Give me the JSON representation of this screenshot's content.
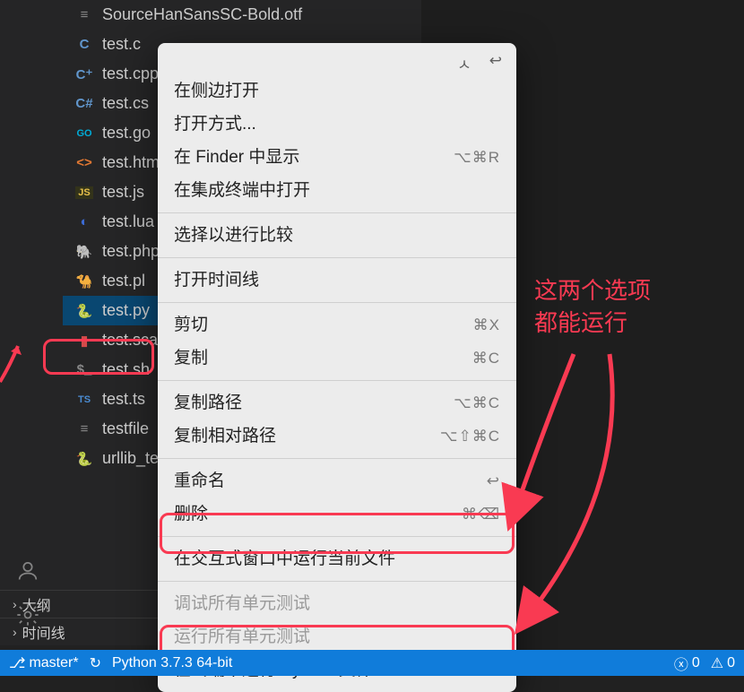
{
  "files": [
    {
      "icon": "≡",
      "cls": "fi-txt",
      "name": "SourceHanSansSC-Bold.otf",
      "sel": false
    },
    {
      "icon": "C",
      "cls": "fi-c",
      "name": "test.c",
      "sel": false
    },
    {
      "icon": "C⁺",
      "cls": "fi-cpp",
      "name": "test.cpp",
      "sel": false
    },
    {
      "icon": "C#",
      "cls": "fi-cs",
      "name": "test.cs",
      "sel": false
    },
    {
      "icon": "GO",
      "cls": "fi-go",
      "name": "test.go",
      "sel": false
    },
    {
      "icon": "<>",
      "cls": "fi-html",
      "name": "test.html",
      "sel": false
    },
    {
      "icon": "JS",
      "cls": "fi-js",
      "name": "test.js",
      "sel": false
    },
    {
      "icon": "◐",
      "cls": "fi-lua",
      "name": "test.lua",
      "sel": false
    },
    {
      "icon": "🐘",
      "cls": "fi-php",
      "name": "test.php",
      "sel": false
    },
    {
      "icon": "🐪",
      "cls": "fi-pl",
      "name": "test.pl",
      "sel": false
    },
    {
      "icon": "🐍",
      "cls": "fi-py",
      "name": "test.py",
      "sel": true
    },
    {
      "icon": "▮",
      "cls": "fi-sc",
      "name": "test.scala",
      "sel": false
    },
    {
      "icon": "$_",
      "cls": "fi-sh",
      "name": "test.sh",
      "sel": false
    },
    {
      "icon": "TS",
      "cls": "fi-ts",
      "name": "test.ts",
      "sel": false
    },
    {
      "icon": "≡",
      "cls": "fi-txt",
      "name": "testfile",
      "sel": false
    },
    {
      "icon": "🐍",
      "cls": "fi-py",
      "name": "urllib_test.py",
      "sel": false
    }
  ],
  "sections": {
    "outline": "大纲",
    "timeline": "时间线"
  },
  "context_menu": {
    "head_left": "ㅅ",
    "head_right": "↩",
    "groups": [
      [
        {
          "label": "在侧边打开",
          "sc": ""
        },
        {
          "label": "打开方式...",
          "sc": ""
        },
        {
          "label": "在 Finder 中显示",
          "sc": "⌥⌘R"
        },
        {
          "label": "在集成终端中打开",
          "sc": ""
        }
      ],
      [
        {
          "label": "选择以进行比较",
          "sc": ""
        }
      ],
      [
        {
          "label": "打开时间线",
          "sc": ""
        }
      ],
      [
        {
          "label": "剪切",
          "sc": "⌘X"
        },
        {
          "label": "复制",
          "sc": "⌘C"
        }
      ],
      [
        {
          "label": "复制路径",
          "sc": "⌥⌘C"
        },
        {
          "label": "复制相对路径",
          "sc": "⌥⇧⌘C"
        }
      ],
      [
        {
          "label": "重命名",
          "sc": "↩"
        },
        {
          "label": "删除",
          "sc": "⌘⌫"
        }
      ],
      [
        {
          "label": "在交互式窗口中运行当前文件",
          "sc": ""
        }
      ],
      [
        {
          "label": "调试所有单元测试",
          "sc": "",
          "disabled": true
        },
        {
          "label": "运行所有单元测试",
          "sc": "",
          "disabled": true
        },
        {
          "label": "在终端中运行 Python 文件",
          "sc": ""
        }
      ]
    ]
  },
  "annotation": {
    "line1": "这两个选项",
    "line2": "都能运行"
  },
  "statusbar": {
    "branch": "master*",
    "sync": "↻",
    "python": "Python 3.7.3 64-bit",
    "errors": "0",
    "warnings": "0"
  }
}
